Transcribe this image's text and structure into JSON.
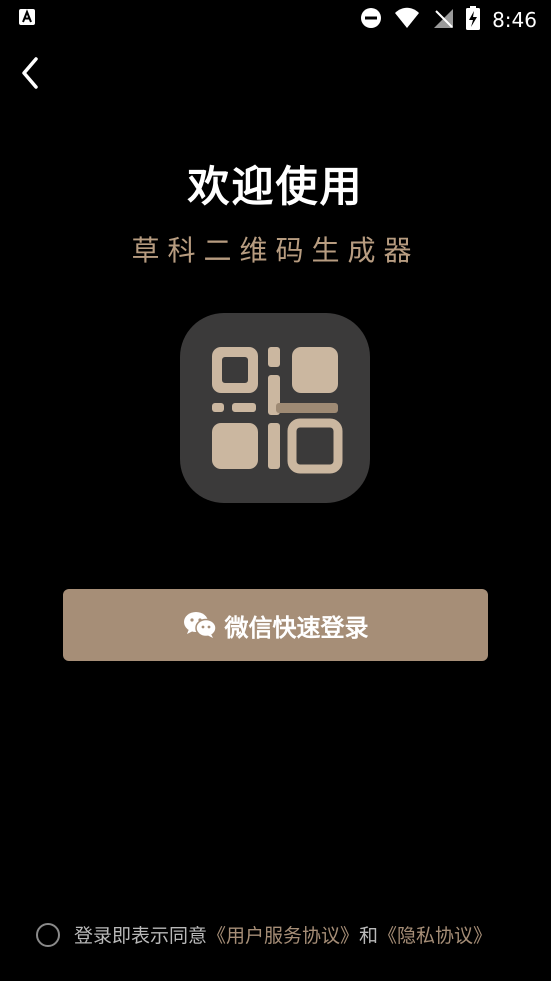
{
  "status_bar": {
    "time": "8:46"
  },
  "title": "欢迎使用",
  "subtitle": "草科二维码生成器",
  "login": {
    "button_label": "微信快速登录"
  },
  "agreement": {
    "prefix": "登录即表示同意",
    "terms_link": "《用户服务协议》",
    "and": "和",
    "privacy_link": "《隐私协议》"
  },
  "colors": {
    "accent": "#a68e77",
    "subtitle": "#b79c80",
    "logo_bg": "#3b3a3a",
    "logo_fg": "#cbb7a0"
  },
  "icons": [
    "notification-a-icon",
    "dnd-icon",
    "wifi-icon",
    "no-sim-icon",
    "battery-charging-icon",
    "back-chevron-icon",
    "wechat-icon",
    "qr-logo-icon"
  ]
}
